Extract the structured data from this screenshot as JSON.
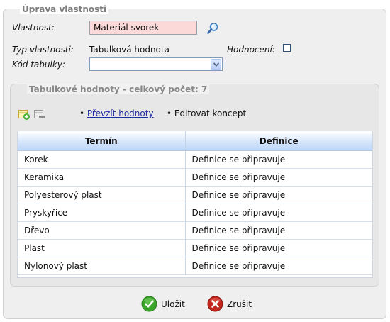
{
  "dialog": {
    "title": "Úprava vlastnosti"
  },
  "form": {
    "property_label": "Vlastnost:",
    "property_value": "Materiál svorek",
    "type_label": "Typ vlastnosti:",
    "type_value": "Tabulková hodnota",
    "rating_label": "Hodnocení:",
    "rating_checked": false,
    "table_code_label": "Kód tabulky:",
    "table_code_value": ""
  },
  "table_values": {
    "title": "Tabulkové hodnoty - celkový počet: 7",
    "toolbar": {
      "add_icon": "add-row-icon",
      "remove_icon": "remove-row-icon",
      "take_values_label": "Převzít hodnoty",
      "edit_draft_label": "Editovat koncept"
    },
    "columns": [
      "Termín",
      "Definice"
    ],
    "rows": [
      {
        "term": "Korek",
        "definition": "Definice se připravuje"
      },
      {
        "term": "Keramika",
        "definition": "Definice se připravuje"
      },
      {
        "term": "Polyesterový plast",
        "definition": "Definice se připravuje"
      },
      {
        "term": "Pryskyřice",
        "definition": "Definice se připravuje"
      },
      {
        "term": "Dřevo",
        "definition": "Definice se připravuje"
      },
      {
        "term": "Plast",
        "definition": "Definice se připravuje"
      },
      {
        "term": "Nylonový plast",
        "definition": "Definice se připravuje"
      }
    ]
  },
  "actions": {
    "save_label": "Uložit",
    "save_icon": "check-circle-icon",
    "cancel_label": "Zrušit",
    "cancel_icon": "x-circle-icon"
  },
  "colors": {
    "required_field_bg": "#fbd9d9",
    "link": "#1f2ea0",
    "save_green": "#3aa52a",
    "cancel_red": "#c0261c"
  }
}
